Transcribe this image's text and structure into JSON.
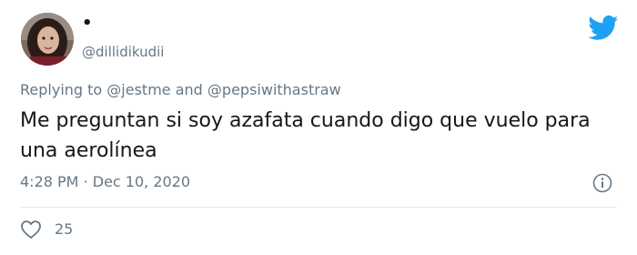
{
  "author": {
    "display_name": "•",
    "handle": "@dillidikudii"
  },
  "reply_context": {
    "prefix": "Replying to",
    "mention_1": "@jestme",
    "conjunction": "and",
    "mention_2": "@pepsiwithastraw"
  },
  "tweet": {
    "text": "Me preguntan si soy azafata cuando digo que vuelo para una aerolínea",
    "time": "4:28 PM",
    "separator": "·",
    "date": "Dec 10, 2020"
  },
  "actions": {
    "like_count": "25"
  },
  "icons": {
    "brand": "twitter-bird-icon",
    "info": "info-icon",
    "like": "heart-icon"
  },
  "colors": {
    "brand": "#1da1f2",
    "secondary_text": "#657786",
    "primary_text": "#14171a"
  }
}
